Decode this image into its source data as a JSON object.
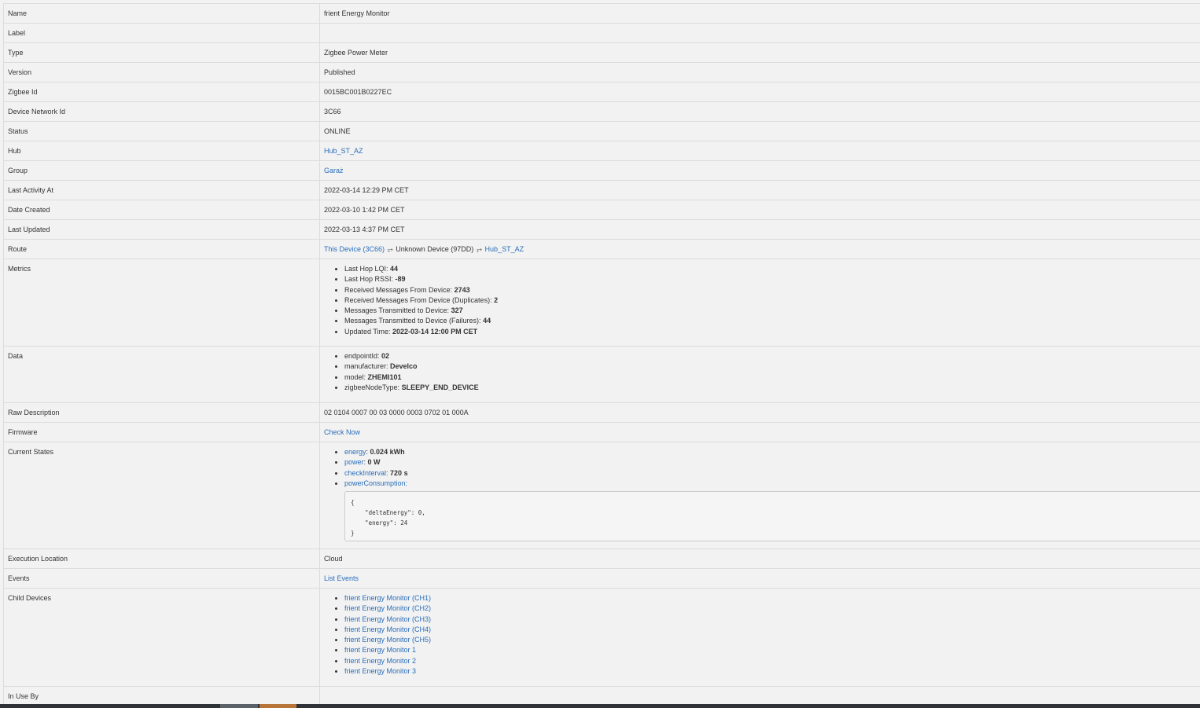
{
  "rows": {
    "name": {
      "label": "Name",
      "value": "frient Energy Monitor"
    },
    "label": {
      "label": "Label",
      "value": ""
    },
    "type": {
      "label": "Type",
      "value": "Zigbee Power Meter"
    },
    "version": {
      "label": "Version",
      "value": "Published"
    },
    "zigbee_id": {
      "label": "Zigbee Id",
      "value": "0015BC001B0227EC"
    },
    "device_network_id": {
      "label": "Device Network Id",
      "value": "3C66"
    },
    "status": {
      "label": "Status",
      "value": "ONLINE"
    },
    "hub": {
      "label": "Hub",
      "value": "Hub_ST_AZ"
    },
    "group": {
      "label": "Group",
      "value": "Garaż"
    },
    "last_activity": {
      "label": "Last Activity At",
      "value": "2022-03-14 12:29 PM CET"
    },
    "date_created": {
      "label": "Date Created",
      "value": "2022-03-10 1:42 PM CET"
    },
    "last_updated": {
      "label": "Last Updated",
      "value": "2022-03-13 4:37 PM CET"
    },
    "route": {
      "label": "Route",
      "this_device": "This Device (3C66)",
      "arrow": "⥅",
      "middle": "Unknown Device (97DD)",
      "hub": "Hub_ST_AZ"
    },
    "metrics": {
      "label": "Metrics",
      "items": [
        {
          "k": "Last Hop LQI: ",
          "v": "44"
        },
        {
          "k": "Last Hop RSSI: ",
          "v": "-89"
        },
        {
          "k": "Received Messages From Device: ",
          "v": "2743"
        },
        {
          "k": "Received Messages From Device (Duplicates): ",
          "v": "2"
        },
        {
          "k": "Messages Transmitted to Device: ",
          "v": "327"
        },
        {
          "k": "Messages Transmitted to Device (Failures): ",
          "v": "44"
        },
        {
          "k": "Updated Time: ",
          "v": "2022-03-14 12:00 PM CET"
        }
      ]
    },
    "data": {
      "label": "Data",
      "items": [
        {
          "k": "endpointId: ",
          "v": "02"
        },
        {
          "k": "manufacturer: ",
          "v": "Develco"
        },
        {
          "k": "model: ",
          "v": "ZHEMI101"
        },
        {
          "k": "zigbeeNodeType: ",
          "v": "SLEEPY_END_DEVICE"
        }
      ]
    },
    "raw_description": {
      "label": "Raw Description",
      "value": "02 0104 0007 00 03 0000 0003 0702 01 000A"
    },
    "firmware": {
      "label": "Firmware",
      "value": "Check Now"
    },
    "current_states": {
      "label": "Current States",
      "items": [
        {
          "k": "energy",
          "v": "0.024 kWh"
        },
        {
          "k": "power",
          "v": "0 W"
        },
        {
          "k": "checkInterval",
          "v": "720 s"
        },
        {
          "k": "powerConsumption",
          "v": ""
        }
      ],
      "json": "{\n    \"deltaEnergy\": 0,\n    \"energy\": 24\n}"
    },
    "execution_location": {
      "label": "Execution Location",
      "value": "Cloud"
    },
    "events": {
      "label": "Events",
      "value": "List Events"
    },
    "child_devices": {
      "label": "Child Devices",
      "items": [
        "frient Energy Monitor (CH1)",
        "frient Energy Monitor (CH2)",
        "frient Energy Monitor (CH3)",
        "frient Energy Monitor (CH4)",
        "frient Energy Monitor (CH5)",
        "frient Energy Monitor 1",
        "frient Energy Monitor 2",
        "frient Energy Monitor 3"
      ]
    },
    "in_use_by": {
      "label": "In Use By",
      "value": ""
    }
  }
}
